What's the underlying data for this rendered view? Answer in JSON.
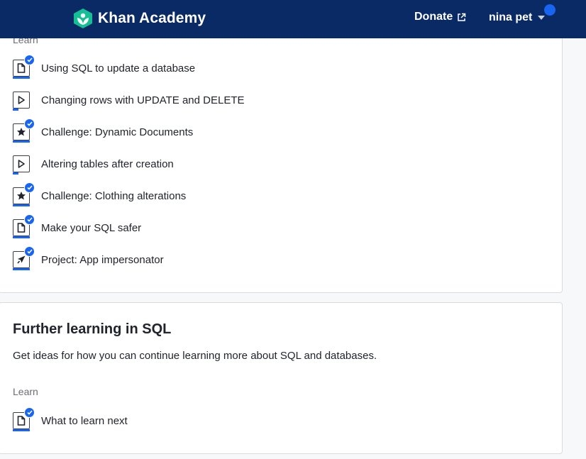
{
  "nav": {
    "brand": "Khan Academy",
    "donate_label": "Donate",
    "user_name": "nina pet",
    "brand_color": "#0a2a66",
    "accent_color": "#1865f2",
    "logo_color": "#14bf96"
  },
  "unit1": {
    "section_label": "Learn",
    "items": [
      {
        "label": "Using SQL to update a database",
        "icon": "article-icon",
        "completed": true
      },
      {
        "label": "Changing rows with UPDATE and DELETE",
        "icon": "video-icon",
        "completed": false
      },
      {
        "label": "Challenge: Dynamic Documents",
        "icon": "challenge-star-icon",
        "completed": true
      },
      {
        "label": "Altering tables after creation",
        "icon": "video-icon",
        "completed": false
      },
      {
        "label": "Challenge: Clothing alterations",
        "icon": "challenge-star-icon",
        "completed": true
      },
      {
        "label": "Make your SQL safer",
        "icon": "article-icon",
        "completed": true
      },
      {
        "label": "Project: App impersonator",
        "icon": "project-rocket-icon",
        "completed": true
      }
    ]
  },
  "unit2": {
    "title": "Further learning in SQL",
    "description": "Get ideas for how you can continue learning more about SQL and databases.",
    "section_label": "Learn",
    "items": [
      {
        "label": "What to learn next",
        "icon": "article-icon",
        "completed": true
      }
    ]
  }
}
